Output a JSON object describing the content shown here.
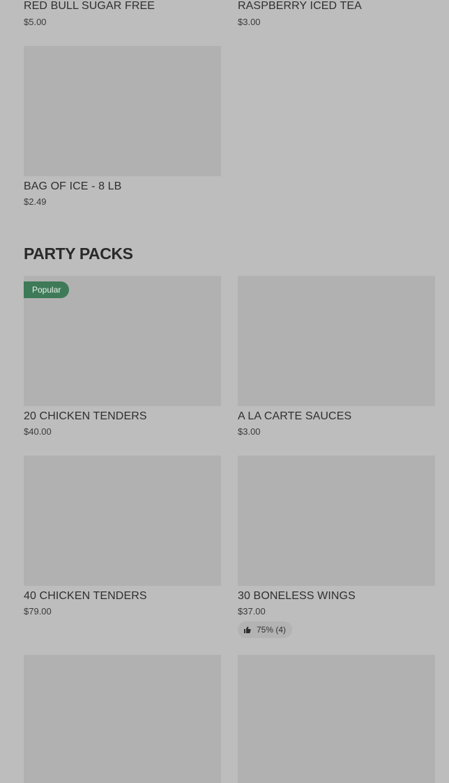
{
  "top_items": [
    {
      "title": "RED BULL SUGAR FREE",
      "price": "$5.00"
    },
    {
      "title": "RASPBERRY ICED TEA",
      "price": "$3.00"
    },
    {
      "title": "BAG OF ICE - 8 LB",
      "price": "$2.49"
    }
  ],
  "party_packs": {
    "heading": "PARTY PACKS",
    "items": [
      {
        "title": "20 CHICKEN TENDERS",
        "price": "$40.00",
        "badge": "Popular"
      },
      {
        "title": "A LA CARTE SAUCES",
        "price": "$3.00"
      },
      {
        "title": "40 CHICKEN TENDERS",
        "price": "$79.00"
      },
      {
        "title": "30 BONELESS WINGS",
        "price": "$37.00",
        "rating": "75% (4)"
      }
    ]
  },
  "icons": {
    "rating_icon": "thumbs-up-icon"
  },
  "colors": {
    "background": "#bdbdbd",
    "image_placeholder": "#b1b1b1",
    "badge": "#3f7a58"
  }
}
